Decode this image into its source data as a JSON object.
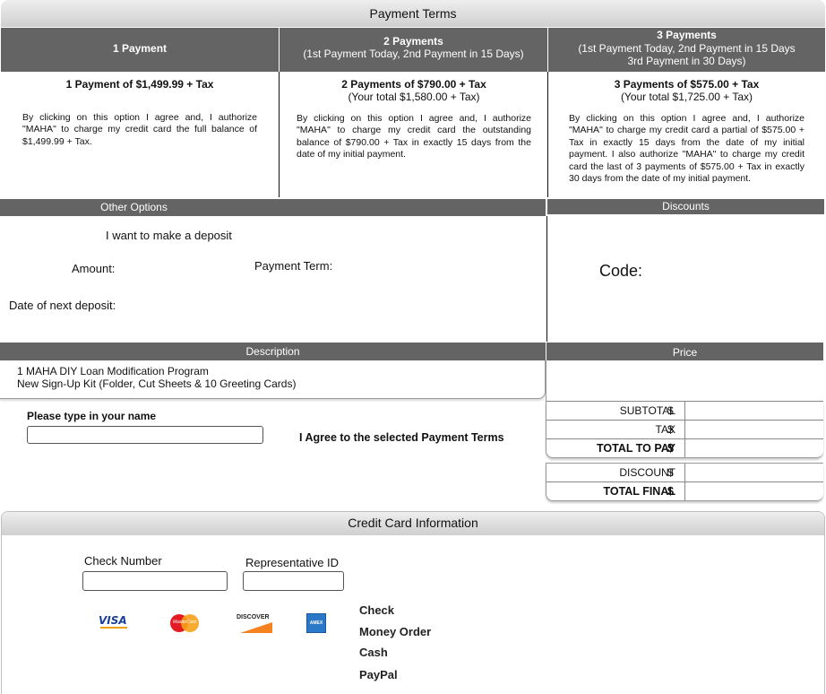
{
  "payment_terms": {
    "title": "Payment Terms",
    "options": [
      {
        "header_title": "1 Payment",
        "header_sub": "",
        "header_sub2": "",
        "title": "1 Payment of $1,499.99 + Tax",
        "subtitle": "",
        "description": "By clicking on this option I agree and, I authorize \"MAHA\" to charge my credit card the full balance of $1,499.99 + Tax."
      },
      {
        "header_title": "2 Payments",
        "header_sub": "(1st Payment Today, 2nd Payment in 15 Days)",
        "header_sub2": "",
        "title": "2 Payments of $790.00 + Tax",
        "subtitle": "(Your total $1,580.00 + Tax)",
        "description": "By clicking on this option I agree and, I authorize \"MAHA\" to charge my credit card the outstanding balance of $790.00 + Tax in exactly 15 days from the date of my initial payment."
      },
      {
        "header_title": "3 Payments",
        "header_sub": "(1st Payment Today, 2nd Payment in 15 Days",
        "header_sub2": "3rd Payment in 30 Days)",
        "title": "3 Payments of $575.00 + Tax",
        "subtitle": "(Your total $1,725.00 + Tax)",
        "description": "By clicking on this option I agree and, I authorize \"MAHA\" to charge my credit card a partial of $575.00 + Tax in exactly 15 days from the date of my initial payment. I also authorize \"MAHA\" to charge my credit card the last of 3 payments of $575.00 + Tax in exactly 30 days from the date of my initial payment."
      }
    ]
  },
  "other_options": {
    "title": "Other Options",
    "deposit_label": "I want to make a deposit",
    "amount_label": "Amount:",
    "payment_term_label": "Payment Term:",
    "next_deposit_label": "Date of next deposit:"
  },
  "discounts": {
    "title": "Discounts",
    "code_label": "Code:"
  },
  "order": {
    "description_header": "Description",
    "price_header": "Price",
    "line1": "1 MAHA DIY Loan Modification Program",
    "line2": "New Sign-Up Kit (Folder, Cut Sheets & 10 Greeting Cards)"
  },
  "signature": {
    "name_label": "Please type in your name",
    "name_value": "",
    "agree_label": "I Agree to the selected Payment Terms"
  },
  "totals": {
    "currency": "$",
    "subtotal_label": "SUBTOTAL",
    "tax_label": "TAX",
    "total_to_pay_label": "TOTAL TO PAY",
    "discount_label": "DISCOUNT",
    "total_final_label": "TOTAL FINAL"
  },
  "credit_card": {
    "title": "Credit Card Information",
    "check_number_label": "Check Number",
    "rep_id_label": "Representative ID",
    "cards": [
      "visa-icon",
      "mastercard-icon",
      "discover-icon",
      "amex-icon"
    ],
    "visa_text": "VISA",
    "mastercard_text": "MasterCard",
    "discover_text": "DISCOVER",
    "amex_text": "AMEX",
    "methods": [
      "Check",
      "Money Order",
      "Cash",
      "PayPal"
    ]
  },
  "colors": {
    "dark_bar": "#646464",
    "header_gradient_top": "#eeeeee",
    "header_gradient_bottom": "#cfcfcf"
  }
}
